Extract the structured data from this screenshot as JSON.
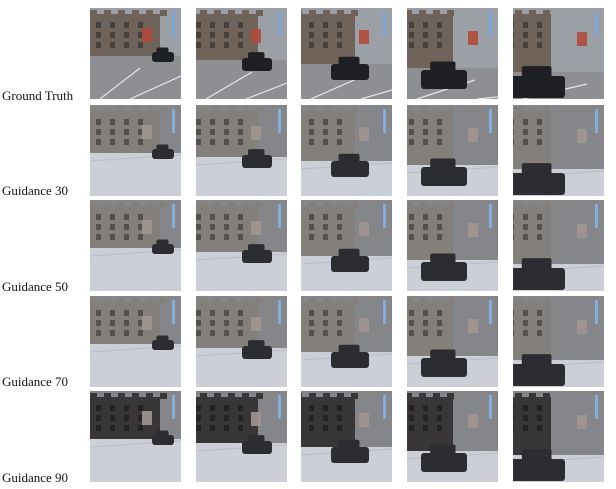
{
  "rows": [
    {
      "label": "Ground Truth",
      "style": "gt"
    },
    {
      "label": "Guidance 30",
      "style": "g30"
    },
    {
      "label": "Guidance 50",
      "style": "g50"
    },
    {
      "label": "Guidance 70",
      "style": "g70"
    },
    {
      "label": "Guidance 90",
      "style": "g90"
    }
  ],
  "columns_per_row": 5,
  "colors": {
    "sky_gt": "#9aa0a6",
    "building_gt": "#6f6258",
    "road_gt": "#8d8f92",
    "car": "#1e2024",
    "sky_gen": "#7d7f82",
    "road_gen": "#c9cdd6",
    "building_dark": "#2c2a2a"
  }
}
